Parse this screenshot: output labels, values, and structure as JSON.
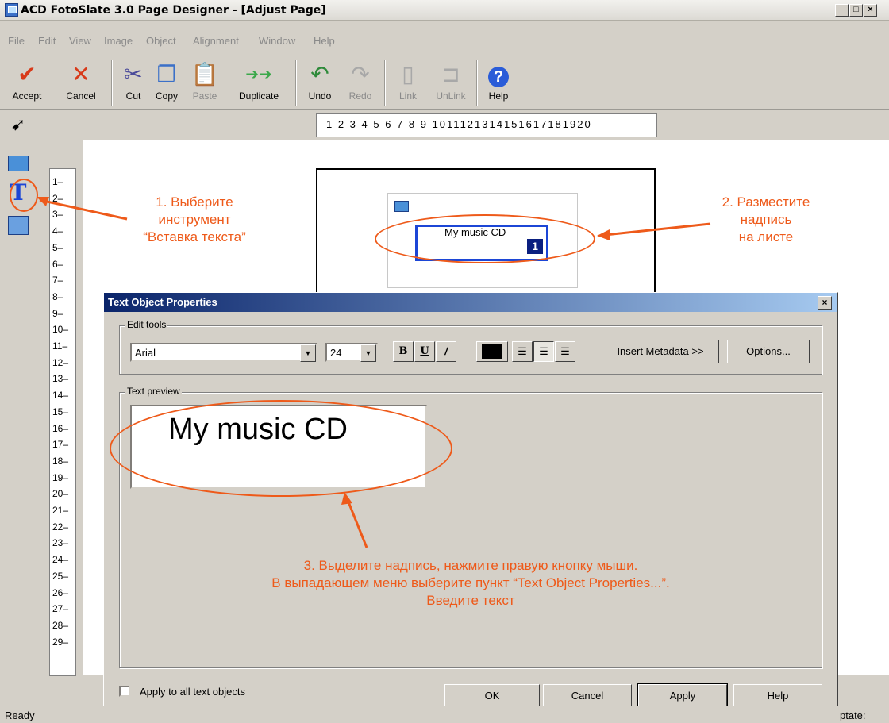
{
  "window": {
    "title": "ACD FotoSlate 3.0 Page Designer - [Adjust Page]"
  },
  "menu": [
    "File",
    "Edit",
    "View",
    "Image",
    "Object",
    "Alignment",
    "Window",
    "Help"
  ],
  "toolbar": {
    "accept": "Accept",
    "cancel": "Cancel",
    "cut": "Cut",
    "copy": "Copy",
    "paste": "Paste",
    "duplicate": "Duplicate",
    "undo": "Undo",
    "redo": "Redo",
    "link": "Link",
    "unlink": "UnLink",
    "help": "Help"
  },
  "ruler": {
    "h_labels": "1 2 3 4 5 6 7 8 9 1011121314151617181920",
    "v_labels": [
      "1",
      "2",
      "3",
      "4",
      "5",
      "6",
      "7",
      "8",
      "9",
      "10",
      "11",
      "12",
      "13",
      "14",
      "15",
      "16",
      "17",
      "18",
      "19",
      "20",
      "21",
      "22",
      "23",
      "24",
      "25",
      "26",
      "27",
      "28",
      "29"
    ]
  },
  "canvas": {
    "textbox_text": "My music CD",
    "textbox_number": "1"
  },
  "dialog": {
    "title": "Text Object Properties",
    "close": "×",
    "edit_tools_label": "Edit tools",
    "font": "Arial",
    "size": "24",
    "bold": "B",
    "underline": "U",
    "italic": "/",
    "insert_metadata": "Insert Metadata >>",
    "options": "Options...",
    "text_preview_label": "Text preview",
    "preview_text": "My music CD",
    "apply_all": "Apply to all text objects",
    "ok": "OK",
    "cancel": "Cancel",
    "apply": "Apply",
    "help": "Help"
  },
  "annotations": {
    "step1": "1. Выберите\nинструмент\n“Вставка текста”",
    "step2": "2. Разместите\nнадпись\nна листе",
    "step3": "3. Выделите надпись, нажмите правую кнопку мыши.\nВ выпадающем меню выберите пункт “Text Object Properties...”.\nВведите текст"
  },
  "status": {
    "left": "Ready",
    "right": "ptate:"
  },
  "colors": {
    "annotation": "#ee5a1a",
    "titlebar": "#0a246a",
    "selection": "#1c46d6"
  }
}
